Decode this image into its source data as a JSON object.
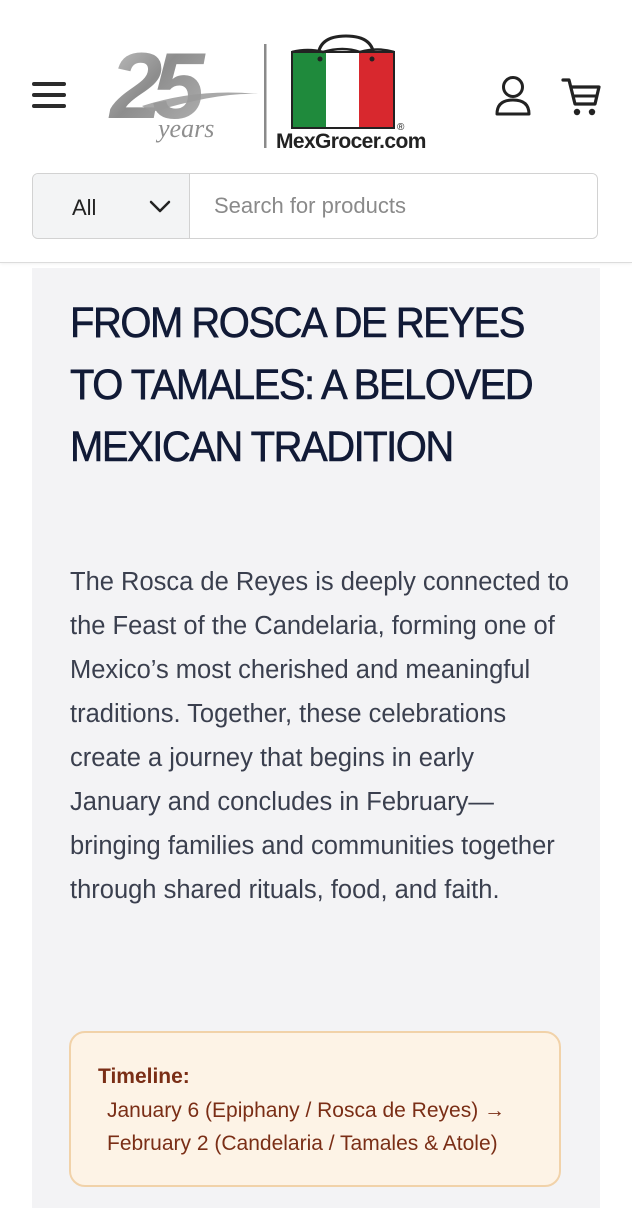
{
  "header": {
    "logo": {
      "anniversary_number": "25",
      "anniversary_word": "years",
      "brand_name": "MexGrocer.com",
      "registered_mark": "®"
    },
    "icons": {
      "menu": "hamburger-menu-icon",
      "account": "user-account-icon",
      "cart": "shopping-cart-icon",
      "dropdown": "chevron-down-icon"
    },
    "search": {
      "category_selected": "All",
      "placeholder": "Search for products"
    }
  },
  "article": {
    "title": "FROM ROSCA DE REYES TO TAMALES: A BELOVED MEXICAN TRADITION",
    "body": "The Rosca de Reyes is deeply connected to the Feast of the Candelaria, forming one of Mexico’s most cherished and meaningful traditions. Together, these celebrations create a journey that begins in early January and concludes in February—bringing families and communities together through shared rituals, food, and faith.",
    "timeline": {
      "label": "Timeline:",
      "line_1": "January 6 (Epiphany / Rosca de Reyes) →",
      "line_2": "February 2 (Candelaria / Tamales & Atole)"
    }
  },
  "colors": {
    "title": "#111a36",
    "body_text": "#3a3f4e",
    "card_background": "#f3f3f5",
    "timeline_background": "#fdf3e6",
    "timeline_border": "#f1d2a9",
    "timeline_text": "#7a2e16",
    "flag_green": "#1f8a3c",
    "flag_red": "#d8282e"
  }
}
